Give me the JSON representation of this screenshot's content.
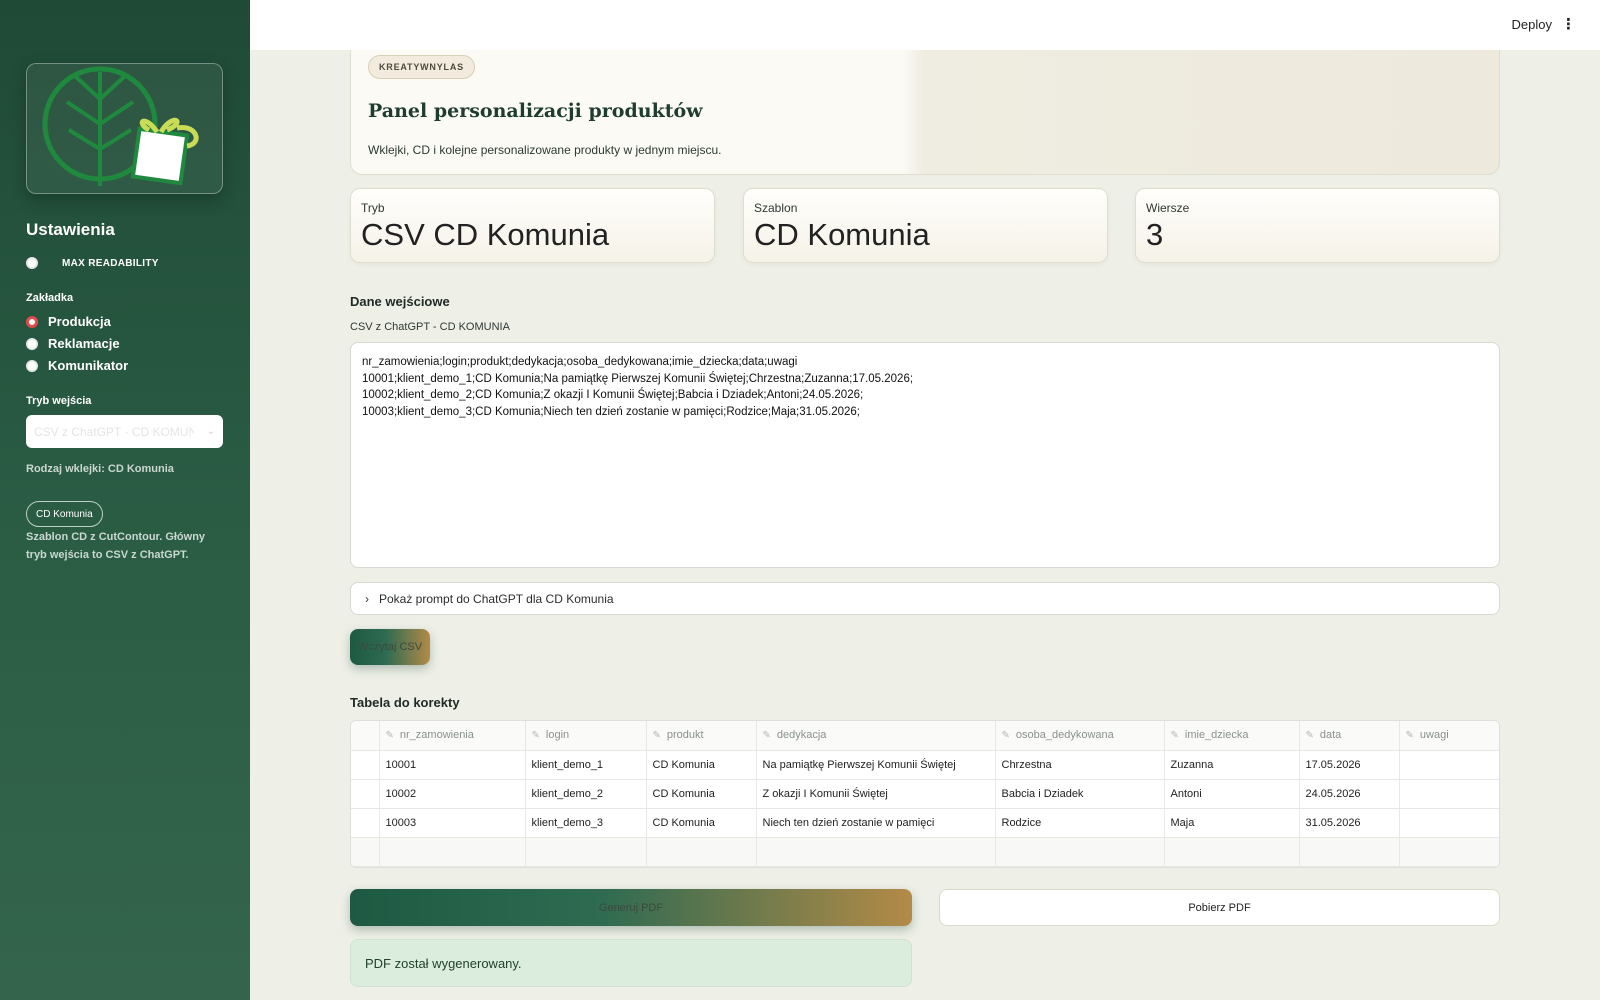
{
  "topbar": {
    "deploy_label": "Deploy",
    "menu_icon": "kebab-menu-icon"
  },
  "sidebar": {
    "logo_icon": "leaf-gift-logo",
    "title": "Ustawienia",
    "readability_label": "MAX READABILITY",
    "tab_group_label": "Zakładka",
    "tabs": [
      {
        "label": "Produkcja",
        "selected": true
      },
      {
        "label": "Reklamacje",
        "selected": false
      },
      {
        "label": "Komunikator",
        "selected": false
      }
    ],
    "input_mode_label": "Tryb wejścia",
    "input_mode_value": "CSV z ChatGPT - CD KOMUNIA",
    "sticker_kind": "Rodzaj wklejki: CD Komunia",
    "template_pill": "CD Komunia",
    "template_desc": "Szablon CD z CutContour. Główny tryb wejścia to CSV z ChatGPT."
  },
  "hero": {
    "badge": "KREATYWNYLAS",
    "title": "Panel personalizacji produktów",
    "subtitle": "Wklejki, CD i kolejne personalizowane produkty w jednym miejscu."
  },
  "metrics": [
    {
      "label": "Tryb",
      "value": "CSV CD Komunia"
    },
    {
      "label": "Szablon",
      "value": "CD Komunia"
    },
    {
      "label": "Wiersze",
      "value": "3"
    }
  ],
  "input_section": {
    "heading": "Dane wejściowe",
    "csv_label": "CSV z ChatGPT - CD KOMUNIA",
    "csv_text": "nr_zamowienia;login;produkt;dedykacja;osoba_dedykowana;imie_dziecka;data;uwagi\n10001;klient_demo_1;CD Komunia;Na pamiątkę Pierwszej Komunii Świętej;Chrzestna;Zuzanna;17.05.2026;\n10002;klient_demo_2;CD Komunia;Z okazji I Komunii Świętej;Babcia i Dziadek;Antoni;24.05.2026;\n10003;klient_demo_3;CD Komunia;Niech ten dzień zostanie w pamięci;Rodzice;Maja;31.05.2026;",
    "expander_label": "Pokaż prompt do ChatGPT dla CD Komunia",
    "load_button": "Wczytaj CSV"
  },
  "table_section": {
    "heading": "Tabela do korekty",
    "columns": [
      "nr_zamowienia",
      "login",
      "produkt",
      "dedykacja",
      "osoba_dedykowana",
      "imie_dziecka",
      "data",
      "uwagi"
    ],
    "rows": [
      [
        "10001",
        "klient_demo_1",
        "CD Komunia",
        "Na pamiątkę Pierwszej Komunii Świętej",
        "Chrzestna",
        "Zuzanna",
        "17.05.2026",
        ""
      ],
      [
        "10002",
        "klient_demo_2",
        "CD Komunia",
        "Z okazji I Komunii Świętej",
        "Babcia i Dziadek",
        "Antoni",
        "24.05.2026",
        ""
      ],
      [
        "10003",
        "klient_demo_3",
        "CD Komunia",
        "Niech ten dzień zostanie w pamięci",
        "Rodzice",
        "Maja",
        "31.05.2026",
        ""
      ]
    ]
  },
  "actions": {
    "generate_pdf": "Generuj PDF",
    "download_pdf": "Pobierz PDF",
    "success_message": "PDF został wygenerowany."
  },
  "colors": {
    "sidebar": "#1f4a36",
    "accent_gold": "#b38a47",
    "radio_selected": "#e04b4b",
    "success_bg": "#dbeedd"
  }
}
